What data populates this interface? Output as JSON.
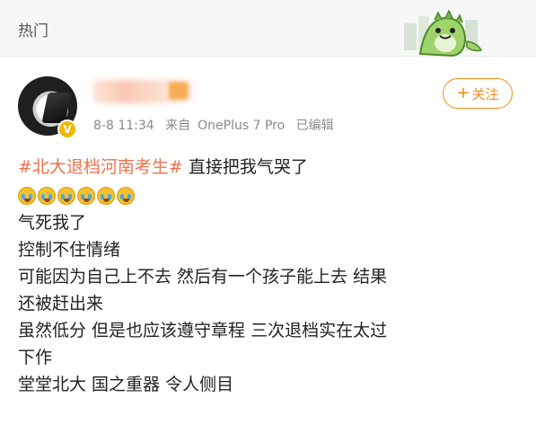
{
  "header": {
    "section_title": "热门"
  },
  "post": {
    "meta": {
      "time": "8-8 11:34",
      "source_prefix": "来自",
      "device": "OnePlus 7 Pro",
      "edited": "已编辑"
    },
    "follow_button": {
      "plus": "+",
      "label": "关注"
    },
    "hashtag": "#北大退档河南考生#",
    "first_line_text": " 直接把我气哭了",
    "emoji_count": 6,
    "lines": [
      "气死我了",
      "控制不住情绪",
      "可能因为自己上不去 然后有一个孩子能上去 结果",
      "还被赶出来",
      "虽然低分 但是也应该遵守章程 三次退档实在太过",
      "下作",
      "堂堂北大 国之重器 令人侧目"
    ]
  },
  "colors": {
    "accent_orange": "#f28a1c",
    "hashtag": "#eb7350",
    "meta_gray": "#8a8a8a"
  }
}
